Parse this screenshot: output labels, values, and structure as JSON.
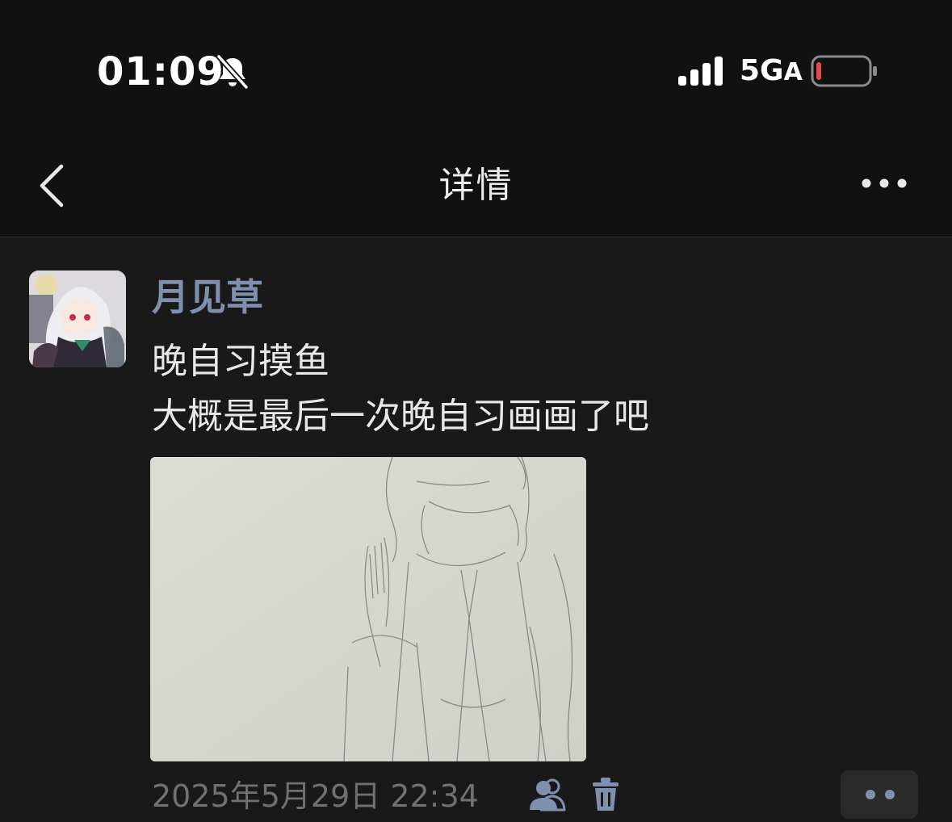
{
  "status_bar": {
    "time": "01:09",
    "network": "5G",
    "network_suffix": "A",
    "silent_icon": "bell-slash-icon",
    "signal_icon": "cellular-signal-icon",
    "battery_icon": "battery-low-icon",
    "battery_color": "#e5484d"
  },
  "nav": {
    "title": "详情",
    "back_icon": "chevron-left-icon",
    "more_icon": "ellipsis-icon"
  },
  "post": {
    "username": "月见草",
    "username_color": "#7f8fae",
    "text": "晚自习摸鱼\n大概是最后一次晚自习画画了吧",
    "timestamp": "2025年5月29日 22:34",
    "visibility_icon": "people-icon",
    "delete_icon": "trash-icon",
    "action_icon": "two-dots-icon"
  }
}
